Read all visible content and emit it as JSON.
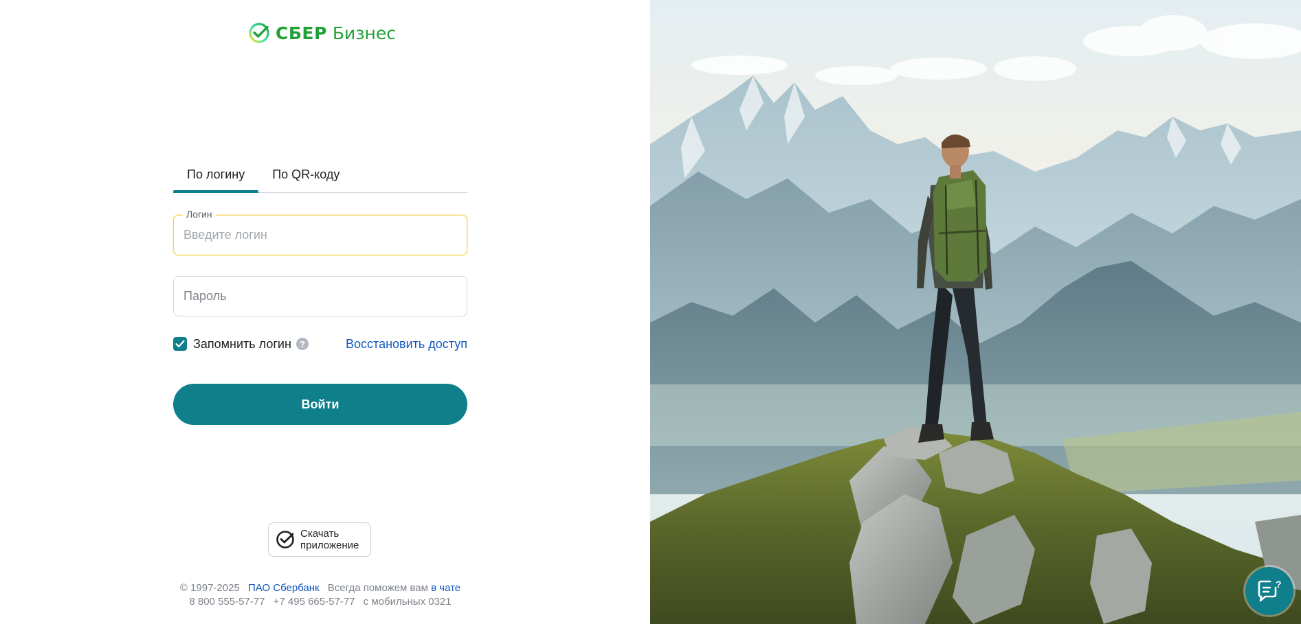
{
  "brand": {
    "name_bold": "СБЕР",
    "name_light": "Бизнес",
    "color": "#21a038"
  },
  "tabs": [
    {
      "label": "По логину",
      "active": true
    },
    {
      "label": "По QR-коду",
      "active": false
    }
  ],
  "login": {
    "label": "Логин",
    "placeholder": "Введите логин",
    "value": ""
  },
  "password": {
    "placeholder": "Пароль",
    "value": ""
  },
  "remember": {
    "label": "Запомнить логин",
    "checked": true
  },
  "restore_link": "Восстановить доступ",
  "submit_label": "Войти",
  "app_download": {
    "line1": "Скачать",
    "line2": "приложение"
  },
  "footer": {
    "copyright": "© 1997-2025",
    "company_link": "ПАО Сбербанк",
    "help_text": "Всегда поможем вам",
    "chat_link": "в чате",
    "phone1": "8 800 555-57-77",
    "phone2": "+7 495 665-57-77",
    "mobile": "с мобильных 0321"
  },
  "colors": {
    "accent": "#107f8c",
    "link": "#1358bf",
    "focus": "#f2d54b"
  },
  "icons": {
    "chat": "chat-help-icon",
    "app": "sber-check-icon",
    "logo": "sber-logo-icon"
  }
}
